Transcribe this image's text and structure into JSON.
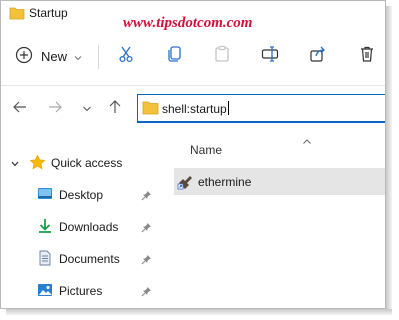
{
  "window": {
    "title": "Startup"
  },
  "watermark": "www.tipsdotcom.com",
  "toolbar": {
    "new_label": "New"
  },
  "address_bar": {
    "value": "shell:startup"
  },
  "columns": {
    "name": "Name"
  },
  "nav_pane": {
    "quick_access": "Quick access",
    "items": [
      {
        "label": "Desktop",
        "icon": "desktop-icon"
      },
      {
        "label": "Downloads",
        "icon": "download-icon"
      },
      {
        "label": "Documents",
        "icon": "document-icon"
      },
      {
        "label": "Pictures",
        "icon": "pictures-icon"
      }
    ]
  },
  "files": [
    {
      "name": "ethermine",
      "icon": "shortcut-icon"
    }
  ],
  "colors": {
    "accent": "#0a66c2",
    "folder": "#f3c13a",
    "selected_row": "#e5e5e5",
    "watermark": "#d4103a"
  }
}
